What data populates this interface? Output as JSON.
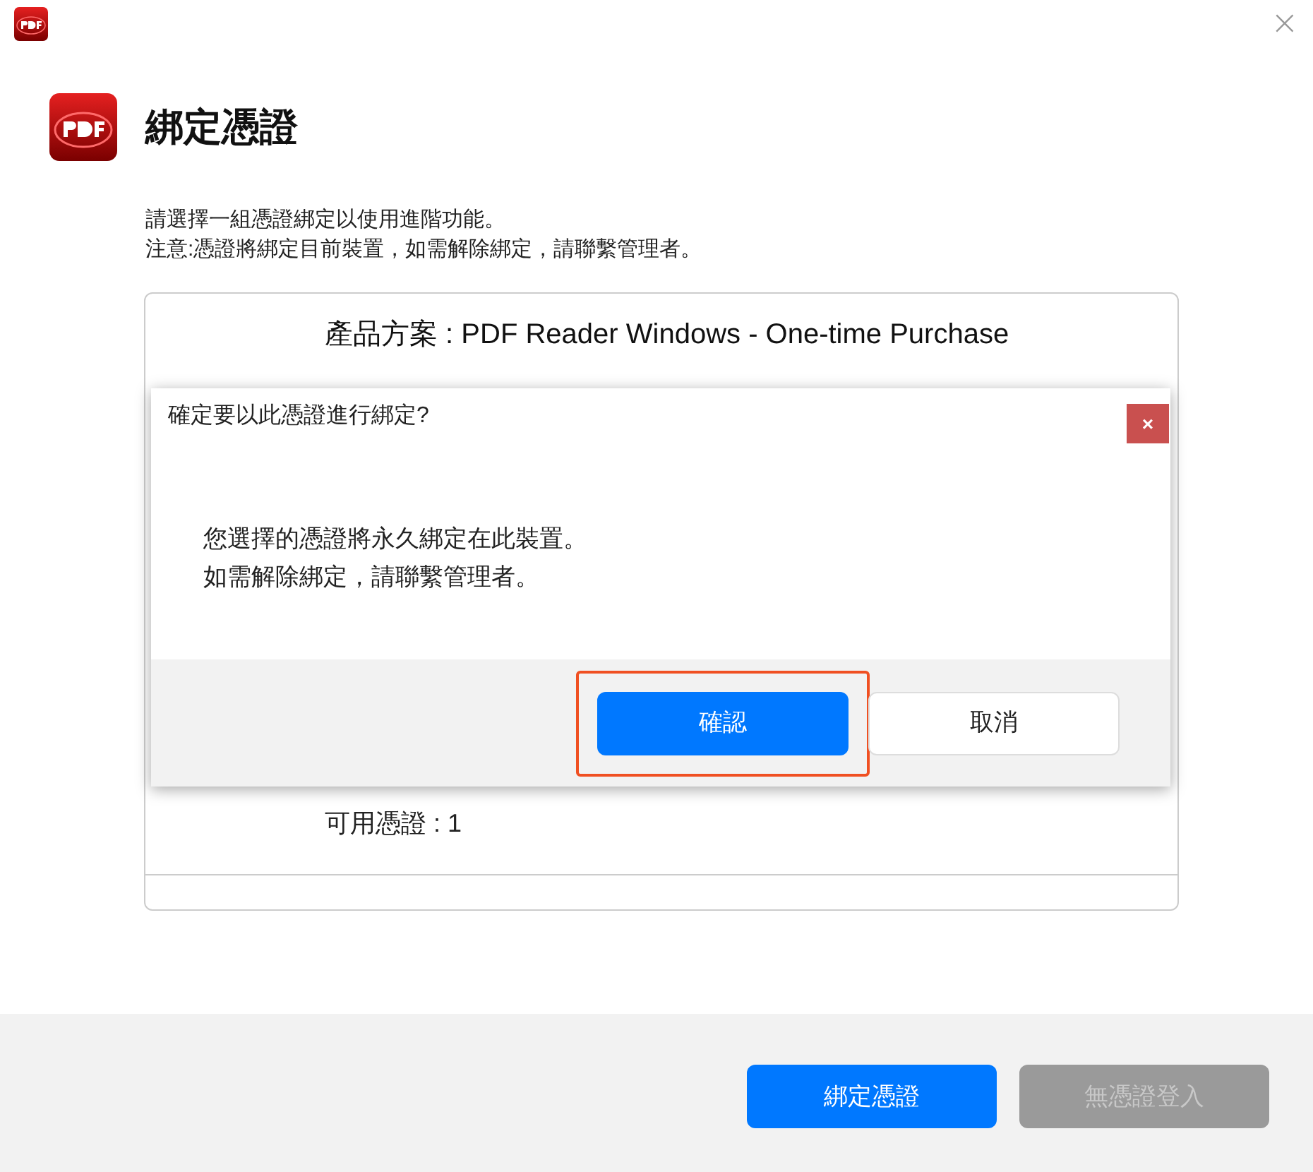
{
  "window": {
    "close": "×"
  },
  "header": {
    "title": "綁定憑證"
  },
  "intro": [
    "請選擇一組憑證綁定以使用進階功能。",
    "注意:憑證將綁定目前裝置，如需解除綁定，請聯繫管理者。"
  ],
  "credential": {
    "plan": "產品方案 : PDF Reader Windows - One-time Purchase",
    "available": "可用憑證 : 1"
  },
  "dialog": {
    "title": "確定要以此憑證進行綁定?",
    "close": "×",
    "message": [
      "您選擇的憑證將永久綁定在此裝置。",
      "如需解除綁定，請聯繫管理者。"
    ],
    "buttons": [
      {
        "label": "確認",
        "kind": "primary",
        "highlighted": true
      },
      {
        "label": "取消",
        "kind": "secondary",
        "highlighted": false
      }
    ]
  },
  "footer": {
    "buttons": [
      {
        "label": "綁定憑證",
        "disabled": false
      },
      {
        "label": "無憑證登入",
        "disabled": true
      }
    ]
  }
}
